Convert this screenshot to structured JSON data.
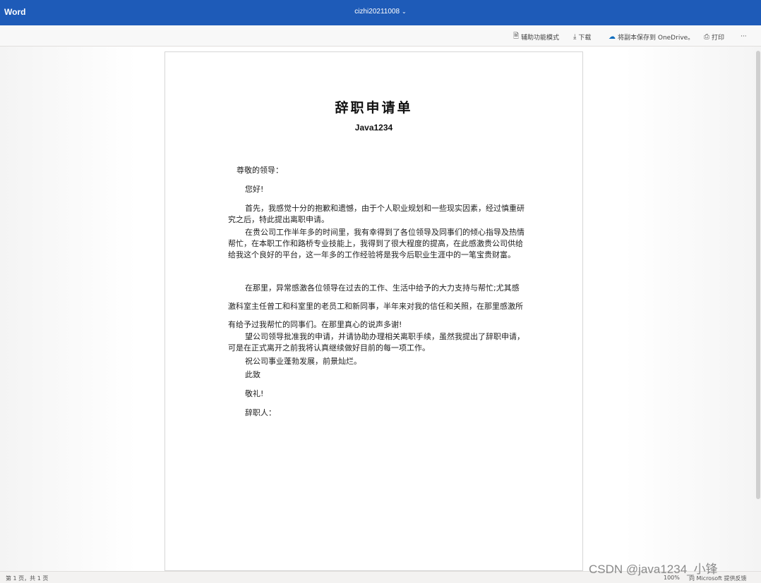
{
  "app": {
    "name": "Word",
    "document_title": "cizhi20211008"
  },
  "toolbar": {
    "accessibility": "辅助功能模式",
    "download": "下载",
    "save_onedrive": "将副本保存到 OneDrive。",
    "print": "打印",
    "more": "···"
  },
  "document": {
    "title": "辞职申请单",
    "subtitle": "Java1234",
    "salutation": "尊敬的领导：",
    "greeting": "您好!",
    "p1": "首先，我感觉十分的抱歉和遗憾，由于个人职业规划和一些现实因素，经过慎重研究之后，特此提出离职申请。",
    "p2": "在贵公司工作半年多的时间里，我有幸得到了各位领导及同事们的倾心指导及热情帮忙，在本职工作和路桥专业技能上，我得到了很大程度的提高，在此感激贵公司供给给我这个良好的平台，这一年多的工作经验将是我今后职业生涯中的一笔宝贵财富。",
    "p3": "在那里，异常感激各位领导在过去的工作、生活中给予的大力支持与帮忙;尤其感激科室主任曾工和科室里的老员工和新同事，半年来对我的信任和关照，在那里感激所有给予过我帮忙的同事们。在那里真心的说声多谢!",
    "p4": "望公司领导批准我的申请，并请协助办理相关离职手续，虽然我提出了辞职申请，可是在正式离开之前我将认真继续做好目前的每一项工作。",
    "p5": "祝公司事业蓬勃发展，前景灿烂。",
    "closing1": "此致",
    "closing2": "敬礼!",
    "signature": "辞职人："
  },
  "status": {
    "page_info": "第 1 页，共 1 页",
    "zoom": "100%",
    "feedback": "向 Microsoft 提供反馈"
  },
  "watermark": "CSDN @java1234_小锋"
}
